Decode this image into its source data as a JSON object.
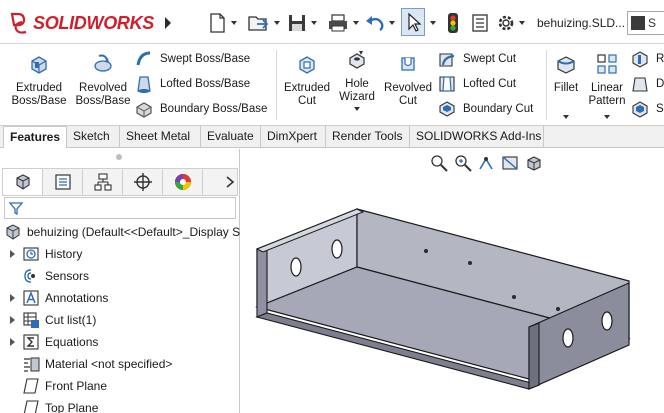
{
  "app": {
    "brand": "SOLIDWORKS",
    "document_title": "behuizing.SLD...",
    "command_search": "S"
  },
  "toolbar": {
    "icons": [
      "new-document-icon",
      "open-icon",
      "save-icon",
      "print-icon",
      "undo-icon",
      "select-icon",
      "rebuild-icon",
      "file-properties-icon",
      "options-icon"
    ]
  },
  "ribbon": {
    "extruded_boss": "Extruded\nBoss/Base",
    "revolved_boss": "Revolved\nBoss/Base",
    "swept_boss": "Swept Boss/Base",
    "lofted_boss": "Lofted Boss/Base",
    "boundary_boss": "Boundary Boss/Base",
    "extruded_cut": "Extruded\nCut",
    "hole_wizard": "Hole\nWizard",
    "revolved_cut": "Revolved\nCut",
    "swept_cut": "Swept Cut",
    "lofted_cut": "Lofted Cut",
    "boundary_cut": "Boundary Cut",
    "fillet": "Fillet",
    "linear_pattern": "Linear\nPattern",
    "overflow": [
      "R",
      "D",
      "S"
    ]
  },
  "tabs": [
    {
      "label": "Features",
      "active": true
    },
    {
      "label": "Sketch",
      "active": false
    },
    {
      "label": "Sheet Metal",
      "active": false
    },
    {
      "label": "Evaluate",
      "active": false
    },
    {
      "label": "DimXpert",
      "active": false
    },
    {
      "label": "Render Tools",
      "active": false
    },
    {
      "label": "SOLIDWORKS Add-Ins",
      "active": false
    }
  ],
  "tree": {
    "root": "behuizing  (Default<<Default>_Display S",
    "items": [
      {
        "label": "History",
        "icon": "history-icon",
        "expandable": true
      },
      {
        "label": "Sensors",
        "icon": "sensors-icon",
        "expandable": false
      },
      {
        "label": "Annotations",
        "icon": "annotations-icon",
        "expandable": true
      },
      {
        "label": "Cut list(1)",
        "icon": "cut-list-icon",
        "expandable": true
      },
      {
        "label": "Equations",
        "icon": "equations-icon",
        "expandable": true
      },
      {
        "label": "Material <not specified>",
        "icon": "material-icon",
        "expandable": false
      },
      {
        "label": "Front Plane",
        "icon": "plane-icon",
        "expandable": false
      },
      {
        "label": "Top Plane",
        "icon": "plane-icon",
        "expandable": false
      }
    ]
  },
  "colors": {
    "brand_red": "#d01f2b",
    "model_face_light": "#9a9cab",
    "model_face_dark": "#6e7080",
    "model_edge": "#1a1a1a",
    "accent_blue": "#2d6db5"
  }
}
